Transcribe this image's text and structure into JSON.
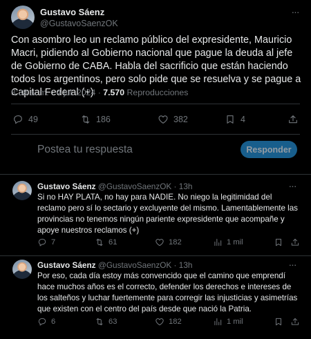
{
  "tweet": {
    "author_name": "Gustavo Sáenz",
    "author_handle": "@GustavoSaenzOK",
    "text": "Con asombro leo un reclamo público del expresidente, Mauricio Macri, pidiendo al Gobierno nacional que pague la deuda al jefe de Gobierno de CABA. Habla del sacrificio que están haciendo todos los argentinos, pero solo pide que se resuelva y se pague a Capital Federal (+)",
    "time": "8:38 a. m. · 4 jul. 2024 · ",
    "views_count": "7.570",
    "views_label": " Reproducciones",
    "stats": {
      "replies": "49",
      "reposts": "186",
      "likes": "382",
      "bookmarks": "4"
    }
  },
  "reply_box": {
    "placeholder": "Postea tu respuesta",
    "button_label": "Responder"
  },
  "replies": [
    {
      "author_name": "Gustavo Sáenz",
      "author_handle": "@GustavoSaenzOK",
      "time": "· 13h",
      "text": "Si no HAY PLATA, no hay para NADIE. No niego la legitimidad del reclamo pero sí lo sectario y excluyente del mismo. Lamentablemente las provincias no tenemos ningún pariente expresidente que acompañe y apoye nuestros reclamos (+)",
      "replies": "7",
      "reposts": "61",
      "likes": "182",
      "views": "1 mil"
    },
    {
      "author_name": "Gustavo Sáenz",
      "author_handle": "@GustavoSaenzOK",
      "time": "· 13h",
      "text": "Por eso, cada día estoy más convencido que el camino que emprendí hace muchos años es el correcto, defender los derechos e intereses de los salteños y luchar fuertemente para corregir las injusticias y asimetrías que existen con el centro del país desde que nació la Patria.",
      "replies": "6",
      "reposts": "63",
      "likes": "182",
      "views": "1 mil"
    }
  ],
  "colors": {
    "background": "#000000",
    "text": "#e7e9ea",
    "muted": "#71767b",
    "divider": "#2f3336",
    "accent": "#1d9bf0"
  }
}
